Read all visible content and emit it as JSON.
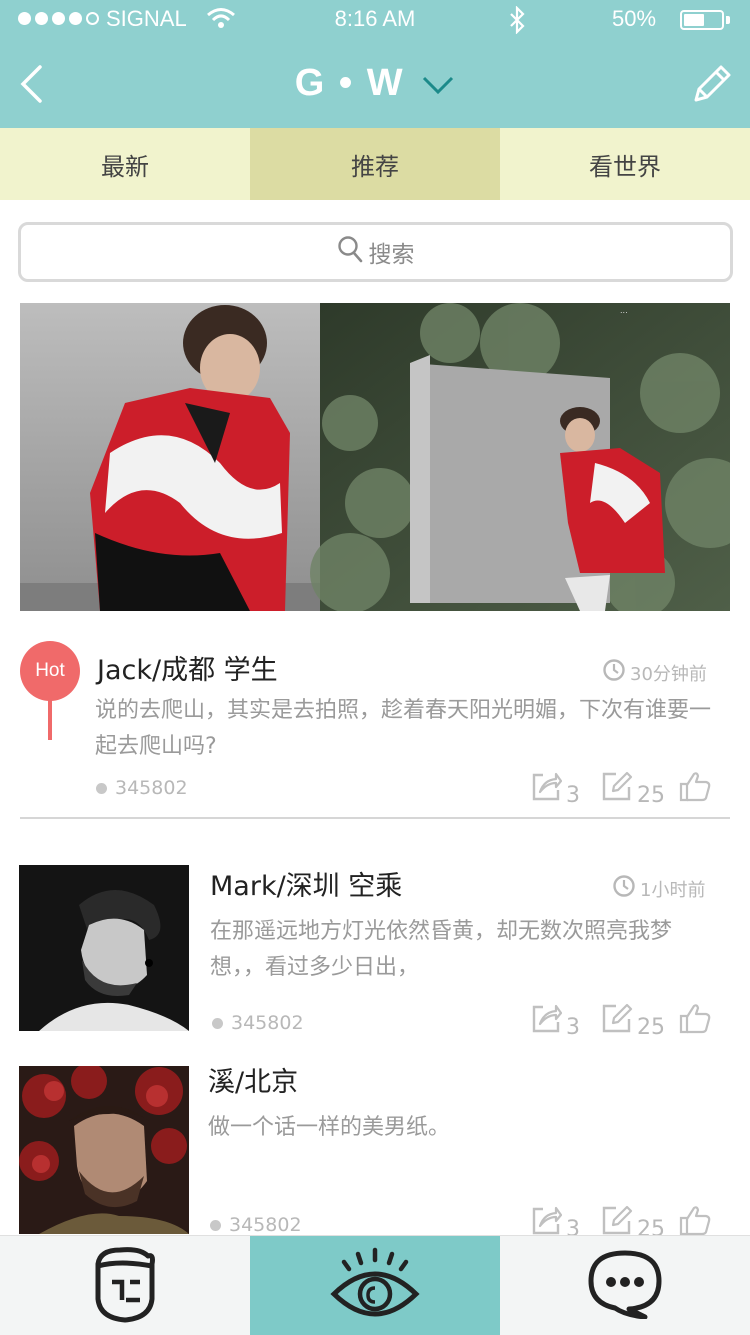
{
  "status": {
    "carrier": "SIGNAL",
    "time": "8:16 AM",
    "battery": "50%"
  },
  "header": {
    "title": "G • W"
  },
  "tabs": [
    {
      "label": "最新"
    },
    {
      "label": "推荐"
    },
    {
      "label": "看世界"
    }
  ],
  "search": {
    "placeholder": "搜索"
  },
  "posts": [
    {
      "badge": "Hot",
      "author": "Jack/成都 学生",
      "time": "30分钟前",
      "content": "说的去爬山，其实是去拍照，趁着春天阳光明媚，下次有谁要一起去爬山吗?",
      "views": "345802",
      "shares": "3",
      "comments": "25"
    },
    {
      "author": "Mark/深圳 空乘",
      "time": "1小时前",
      "content": "在那遥远地方灯光依然昏黄，却无数次照亮我梦想，，看过多少日出，",
      "views": "345802",
      "shares": "3",
      "comments": "25"
    },
    {
      "author": "溪/北京",
      "content": "做一个话一样的美男纸。",
      "views": "345802",
      "shares": "3",
      "comments": "25"
    }
  ],
  "colors": {
    "accent": "#8fd0cf",
    "tab_bg": "#f1f3cd",
    "tab_active": "#dcdca3",
    "hot": "#f06a6a"
  }
}
